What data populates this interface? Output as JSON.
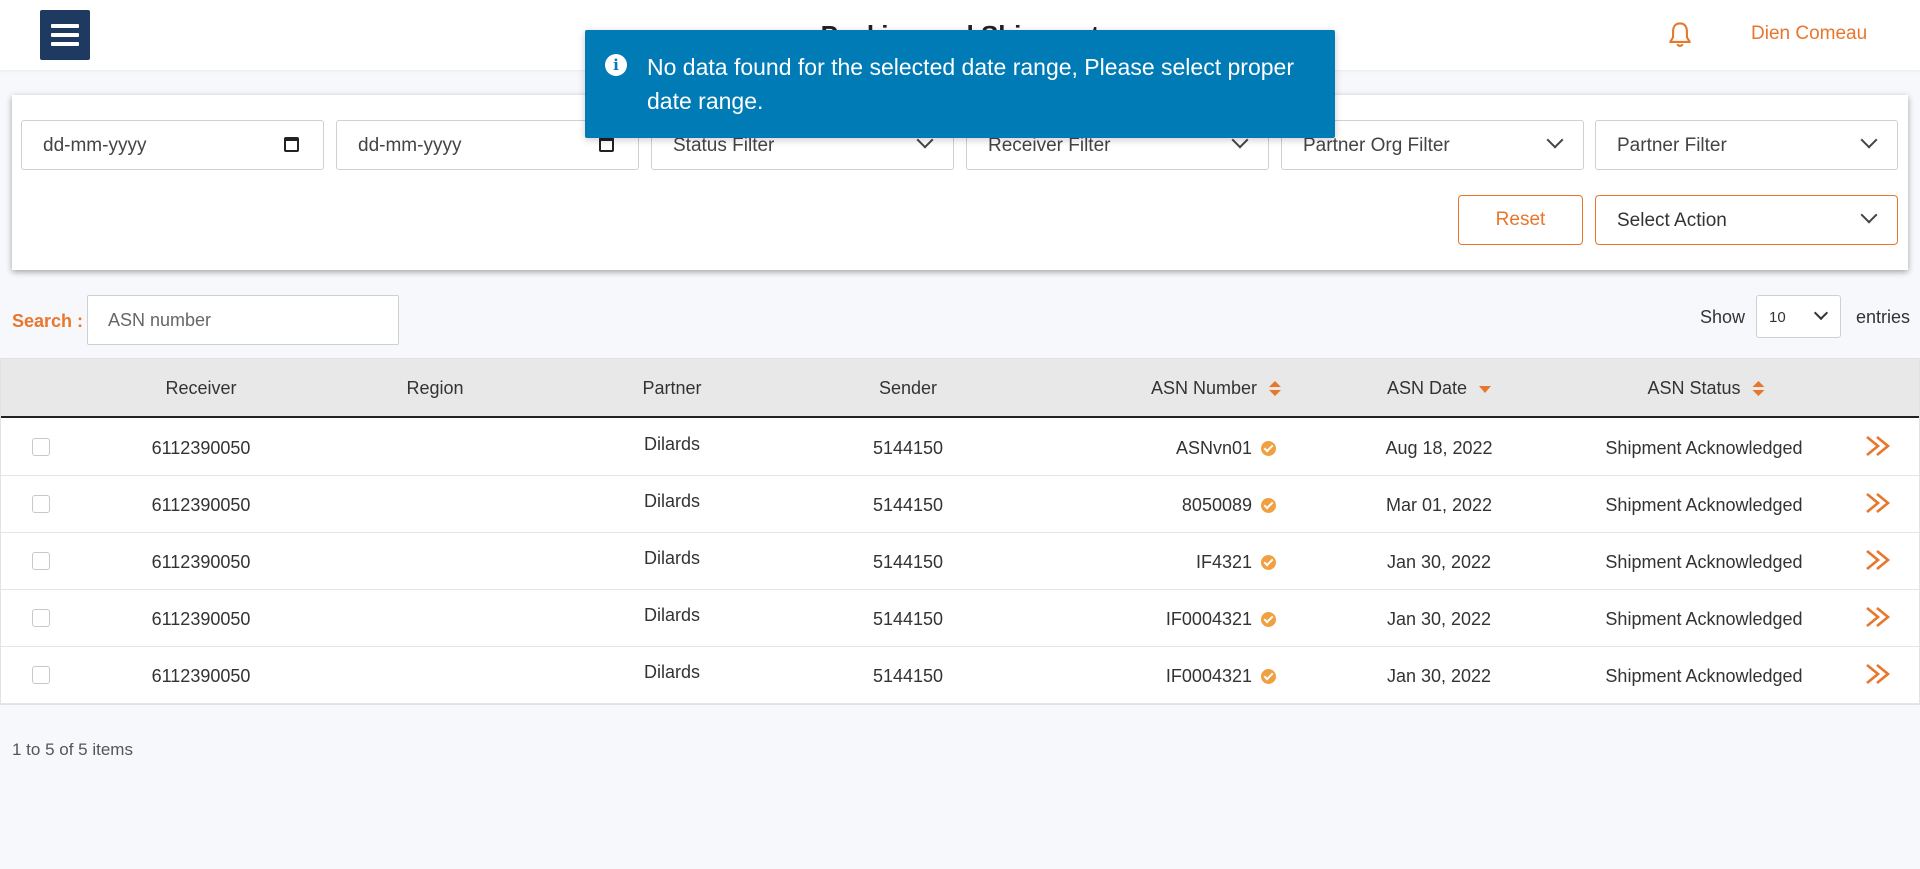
{
  "header": {
    "title": "Packing and Shipment",
    "user_name": "Dien Comeau"
  },
  "toast": {
    "message": "No data found for the selected date range, Please select proper date range."
  },
  "filters": {
    "from_date_placeholder": "dd-mm-yyyy",
    "to_date_placeholder": "dd-mm-yyyy",
    "status": "Status Filter",
    "receiver": "Receiver Filter",
    "partner_org": "Partner Org Filter",
    "partner": "Partner Filter",
    "reset_label": "Reset",
    "action_label": "Select Action"
  },
  "search": {
    "label": "Search :",
    "placeholder": "ASN number"
  },
  "page_size": {
    "show_label": "Show",
    "value": "10",
    "entries_label": "entries"
  },
  "table": {
    "columns": [
      "Receiver",
      "Region",
      "Partner",
      "Sender",
      "ASN Number",
      "ASN Date",
      "ASN Status"
    ],
    "rows": [
      {
        "receiver": "6112390050",
        "region": "",
        "partner": "Dilards",
        "sender": "5144150",
        "asn_number": "ASNvn01",
        "asn_date": "Aug 18, 2022",
        "status": "Shipment Acknowledged"
      },
      {
        "receiver": "6112390050",
        "region": "",
        "partner": "Dilards",
        "sender": "5144150",
        "asn_number": "8050089",
        "asn_date": "Mar 01, 2022",
        "status": "Shipment Acknowledged"
      },
      {
        "receiver": "6112390050",
        "region": "",
        "partner": "Dilards",
        "sender": "5144150",
        "asn_number": "IF4321",
        "asn_date": "Jan 30, 2022",
        "status": "Shipment Acknowledged"
      },
      {
        "receiver": "6112390050",
        "region": "",
        "partner": "Dilards",
        "sender": "5144150",
        "asn_number": "IF0004321",
        "asn_date": "Jan 30, 2022",
        "status": "Shipment Acknowledged"
      },
      {
        "receiver": "6112390050",
        "region": "",
        "partner": "Dilards",
        "sender": "5144150",
        "asn_number": "IF0004321",
        "asn_date": "Jan 30, 2022",
        "status": "Shipment Acknowledged"
      }
    ]
  },
  "pagination": {
    "info": "1 to 5 of 5 items"
  },
  "colors": {
    "accent": "#e8762b",
    "menu_bg": "#1f3a60",
    "toast_bg": "#007bb5",
    "check_icon": "#f0a040"
  },
  "icons": [
    "menu-icon",
    "bell-icon",
    "info-icon",
    "calendar-icon",
    "chevron-down-icon",
    "sort-icon",
    "sort-desc-icon",
    "check-circle-icon",
    "double-chevron-right-icon"
  ]
}
